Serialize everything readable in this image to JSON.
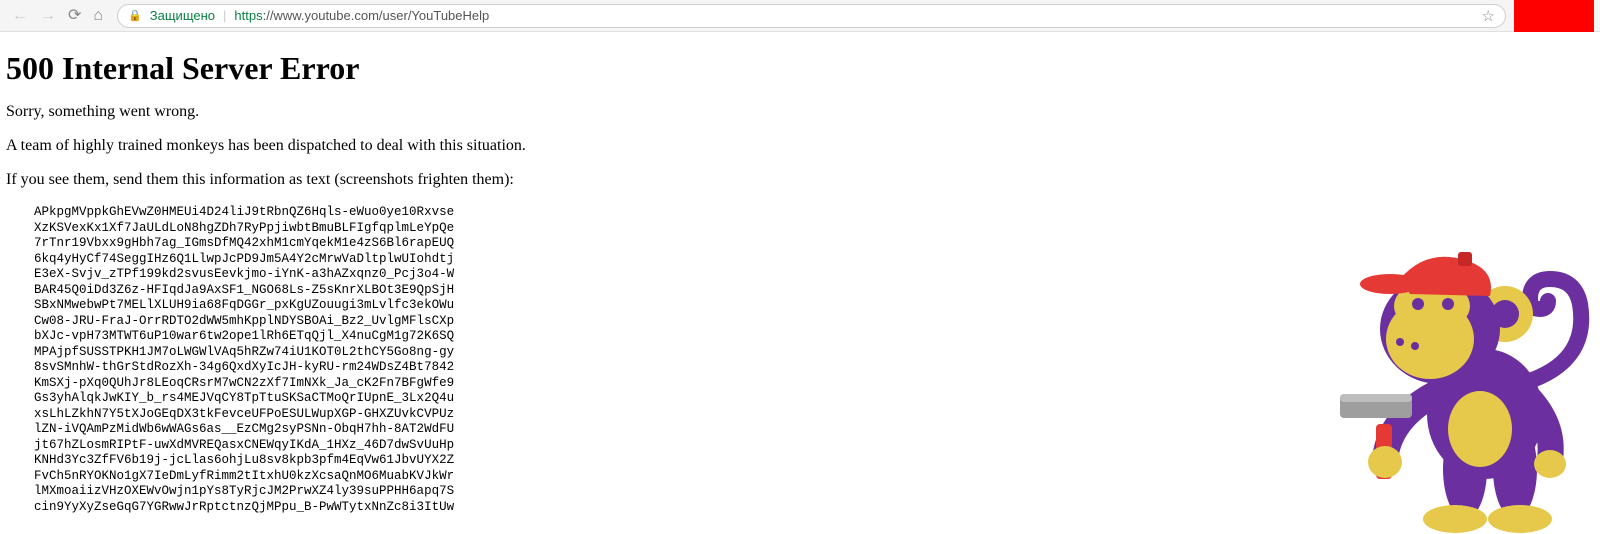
{
  "browser": {
    "secure_label": "Защищено",
    "url_https": "https",
    "url_rest": "://www.youtube.com/user/YouTubeHelp"
  },
  "page": {
    "title": "500 Internal Server Error",
    "msg1": "Sorry, something went wrong.",
    "msg2": "A team of highly trained monkeys has been dispatched to deal with this situation.",
    "msg3": "If you see them, send them this information as text (screenshots frighten them):",
    "dump": "APkpgMVppkGhEVwZ0HMEUi4D24liJ9tRbnQZ6Hqls-eWuo0ye10Rxvse\nXzKSVexKx1Xf7JaULdLoN8hgZDh7RyPpjiwbtBmuBLFIgfqplmLeYpQe\n7rTnr19Vbxx9gHbh7ag_IGmsDfMQ42xhM1cmYqekM1e4zS6Bl6rapEUQ\n6kq4yHyCf74SeggIHz6Q1LlwpJcPD9Jm5A4Y2cMrwVaDltplwUIohdtj\nE3eX-Svjv_zTPf199kd2svusEevkjmo-iYnK-a3hAZxqnz0_Pcj3o4-W\nBAR45Q0iDd3Z6z-HFIqdJa9AxSF1_NGO68Ls-Z5sKnrXLBOt3E9QpSjH\nSBxNMwebwPt7MELlXLUH9ia68FqDGGr_pxKgUZouugi3mLvlfc3ekOWu\nCw08-JRU-FraJ-OrrRDTO2dWW5mhKpplNDYSBOAi_Bz2_UvlgMFlsCXp\nbXJc-vpH73MTWT6uP10war6tw2ope1lRh6ETqQjl_X4nuCgM1g72K6SQ\nMPAjpfSUSSTPKH1JM7oLWGWlVAq5hRZw74iU1KOT0L2thCY5Go8ng-gy\n8svSMnhW-thGrStdRozXh-34g6QxdXyIcJH-kyRU-rm24WDsZ4Bt7842\nKmSXj-pXq0QUhJr8LEoqCRsrM7wCN2zXf7ImNXk_Ja_cK2Fn7BFgWfe9\nGs3yhAlqkJwKIY_b_rs4MEJVqCY8TpTtuSKSaCTMoQrIUpnE_3Lx2Q4u\nxsLhLZkhN7Y5tXJoGEqDX3tkFevceUFPoESULWupXGP-GHXZUvkCVPUz\nlZN-iVQAmPzMidWb6wWAGs6as__EzCMg2syPSNn-ObqH7hh-8AT2WdFU\njt67hZLosmRIPtF-uwXdMVREQasxCNEWqyIKdA_1HXz_46D7dwSvUuHp\nKNHd3Yc3ZfFV6b19j-jcLlas6ohjLu8sv8kpb3pfm4EqVw61JbvUYX2Z\nFvCh5nRYOKNo1gX7IeDmLyfRimm2tItxhU0kzXcsaQnMO6MuabKVJkWr\nlMXmoaiizVHzOXEWvOwjn1pYs8TyRjcJM2PrwXZ4ly39suPPHH6apq7S\ncin9YyXyZseGqG7YGRwwJrRptctnzQjMPpu_B-PwWTytxNnZc8i3ItUw"
  }
}
